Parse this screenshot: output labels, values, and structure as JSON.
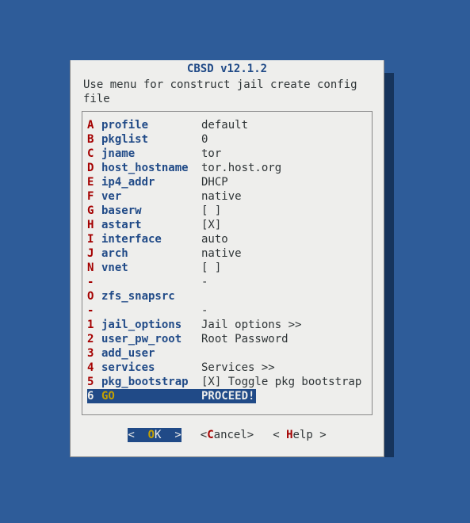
{
  "title": "CBSD v12.1.2",
  "instruction": "Use menu for construct jail create config file",
  "items": [
    {
      "key": "A",
      "name": "profile",
      "value": "default"
    },
    {
      "key": "B",
      "name": "pkglist",
      "value": "0"
    },
    {
      "key": "C",
      "name": "jname",
      "value": "tor"
    },
    {
      "key": "D",
      "name": "host_hostname",
      "value": "tor.host.org"
    },
    {
      "key": "E",
      "name": "ip4_addr",
      "value": "DHCP"
    },
    {
      "key": "F",
      "name": "ver",
      "value": "native"
    },
    {
      "key": "G",
      "name": "baserw",
      "value": "[ ]"
    },
    {
      "key": "H",
      "name": "astart",
      "value": "[X]"
    },
    {
      "key": "I",
      "name": "interface",
      "value": "auto"
    },
    {
      "key": "J",
      "name": "arch",
      "value": "native"
    },
    {
      "key": "N",
      "name": "vnet",
      "value": "[ ]"
    },
    {
      "key": "-",
      "name": "",
      "value": "-"
    },
    {
      "key": "O",
      "name": "zfs_snapsrc",
      "value": ""
    },
    {
      "key": "-",
      "name": "",
      "value": "-"
    },
    {
      "key": "1",
      "name": "jail_options",
      "value": "Jail options >>"
    },
    {
      "key": "2",
      "name": "user_pw_root",
      "value": "Root Password"
    },
    {
      "key": "3",
      "name": "add_user",
      "value": ""
    },
    {
      "key": "4",
      "name": "services",
      "value": "Services >>"
    },
    {
      "key": "5",
      "name": "pkg_bootstrap",
      "value": "[X] Toggle pkg bootstrap"
    },
    {
      "key": "6",
      "name": "GO",
      "value": "PROCEED!",
      "selected": true
    }
  ],
  "buttons": {
    "ok": {
      "pre": "<  ",
      "hot": "O",
      "rest": "K  >",
      "selected": true
    },
    "cancel": {
      "pre": "<",
      "hot": "C",
      "rest": "ancel>"
    },
    "help": {
      "pre": "< ",
      "hot": "H",
      "rest": "elp >"
    }
  }
}
